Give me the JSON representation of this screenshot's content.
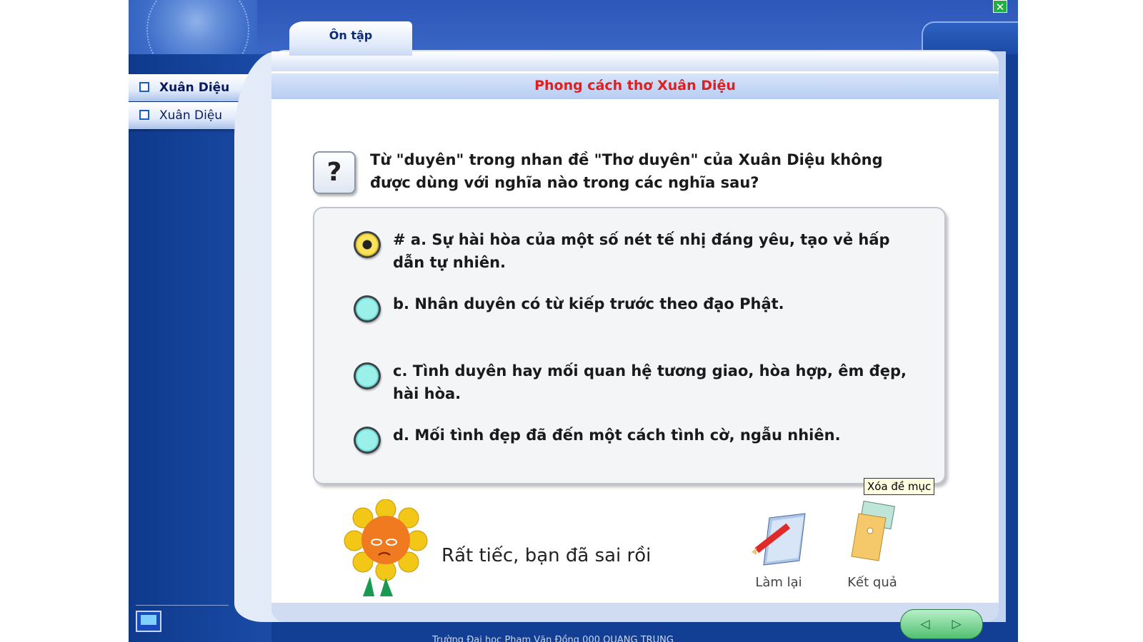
{
  "tab": {
    "label": "Ôn tập"
  },
  "sidebar": {
    "items": [
      {
        "label": "Xuân Diệu",
        "active": true
      },
      {
        "label": "Xuân Diệu",
        "active": false
      }
    ]
  },
  "panel": {
    "title": "Phong cách thơ Xuân Diệu"
  },
  "question": {
    "icon": "?",
    "text": "Từ \"duyên\" trong nhan đề \"Thơ duyên\" của Xuân Diệu không được dùng với nghĩa nào trong các nghĩa sau?"
  },
  "options": [
    {
      "text": "# a. Sự hài hòa của một số nét tế nhị đáng yêu, tạo vẻ hấp dẫn tự nhiên.",
      "selected": true
    },
    {
      "text": "b. Nhân duyên có từ kiếp trước theo đạo Phật.",
      "selected": false
    },
    {
      "text": "c. Tình duyên hay mối quan hệ tương giao, hòa hợp, êm đẹp, hài hòa.",
      "selected": false
    },
    {
      "text": "d. Mối tình đẹp đã đến một cách tình cờ, ngẫu nhiên.",
      "selected": false
    }
  ],
  "tooltip": "Xóa đề mục",
  "feedback": "Rất tiếc, bạn đã sai rồi",
  "buttons": {
    "retry": "Làm lại",
    "result": "Kết quả"
  },
  "nav": {
    "prev": "◁",
    "next": "▷"
  },
  "footer": "Trường Đại học Phạm Văn Đồng 000 QUANG TRUNG",
  "colors": {
    "title_red": "#e02020",
    "app_blue": "#123f93"
  }
}
